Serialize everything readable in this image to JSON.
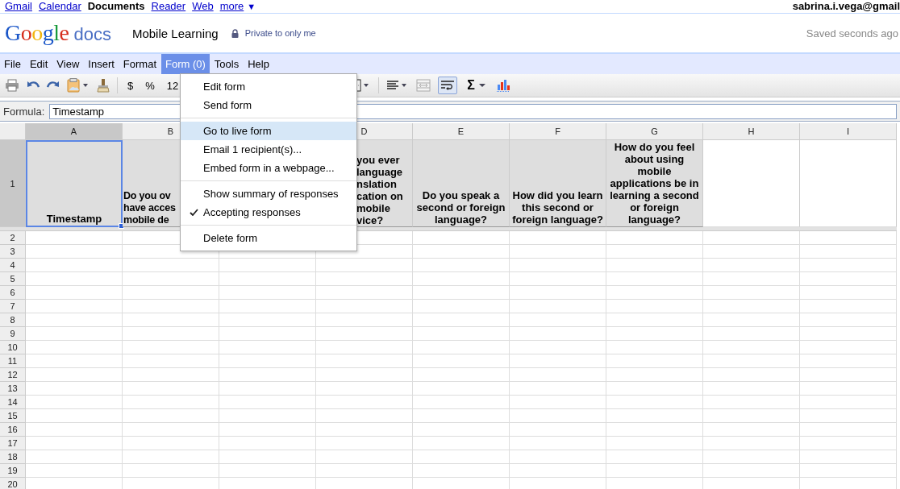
{
  "top_links": [
    {
      "label": "Gmail",
      "selected": false
    },
    {
      "label": "Calendar",
      "selected": false
    },
    {
      "label": "Documents",
      "selected": true
    },
    {
      "label": "Reader",
      "selected": false
    },
    {
      "label": "Web",
      "selected": false
    },
    {
      "label": "more",
      "selected": false
    }
  ],
  "more_arrow": "▼",
  "account": "sabrina.i.vega@gmail",
  "logo": {
    "brand": "Google",
    "product": "docs"
  },
  "doc_title": "Mobile Learning",
  "privacy": "Private to only me",
  "save_status": "Saved seconds ago",
  "menu": [
    {
      "label": "File",
      "selected": false
    },
    {
      "label": "Edit",
      "selected": false
    },
    {
      "label": "View",
      "selected": false
    },
    {
      "label": "Insert",
      "selected": false
    },
    {
      "label": "Format",
      "selected": false
    },
    {
      "label": "Form (0)",
      "selected": true
    },
    {
      "label": "Tools",
      "selected": false
    },
    {
      "label": "Help",
      "selected": false
    }
  ],
  "toolbar_left": [
    {
      "kind": "print"
    },
    {
      "kind": "undo"
    },
    {
      "kind": "redo"
    },
    {
      "kind": "paste"
    },
    {
      "kind": "brush"
    },
    {
      "kind": "sep"
    },
    {
      "kind": "text",
      "label": "$"
    },
    {
      "kind": "text",
      "label": "%"
    },
    {
      "kind": "text",
      "label": "12"
    }
  ],
  "toolbar_right": [
    {
      "kind": "borders"
    },
    {
      "kind": "sep"
    },
    {
      "kind": "align"
    },
    {
      "kind": "merge"
    },
    {
      "kind": "wrap",
      "on": true
    },
    {
      "kind": "sum",
      "label": "Σ"
    },
    {
      "kind": "chart"
    }
  ],
  "formula": {
    "label": "Formula:",
    "value": "Timestamp"
  },
  "columns": [
    {
      "label": "A",
      "selected": true
    },
    {
      "label": "B",
      "selected": false
    },
    {},
    {
      "label": "D",
      "selected": false
    },
    {
      "label": "E",
      "selected": false
    },
    {
      "label": "F",
      "selected": false
    },
    {
      "label": "G",
      "selected": false
    },
    {
      "label": "H",
      "selected": false
    },
    {
      "label": "I",
      "selected": false
    }
  ],
  "header_row": {
    "number": "1",
    "cells": [
      {
        "kind": "question",
        "text": "Timestamp",
        "selected": true
      },
      {
        "kind": "cut_right",
        "text": "Do you ov\nhave acces\nmobile de",
        "selected": false
      },
      {
        "kind": "question"
      },
      {
        "kind": "cut_left",
        "text": "you ever\nlanguage\nnslation\ncation on\nmobile\nvice?",
        "selected": false
      },
      {
        "kind": "question",
        "text": "Do you speak a second or foreign language?",
        "selected": false
      },
      {
        "kind": "question",
        "text": "How did you learn this second or foreign language?",
        "selected": false
      },
      {
        "kind": "question",
        "text": "How do you feel about using mobile applications be in learning a second or foreign language?",
        "selected": false
      },
      {
        "kind": "blank",
        "selected": false
      },
      {
        "kind": "blank",
        "selected": false
      }
    ]
  },
  "row_numbers": [
    "2",
    "3",
    "4",
    "5",
    "6",
    "7",
    "8",
    "9",
    "10",
    "11",
    "12",
    "13",
    "14",
    "15",
    "16",
    "17",
    "18",
    "19",
    "20"
  ],
  "form_menu": [
    [
      {
        "label": "Edit form",
        "selected": false,
        "checked": false
      },
      {
        "label": "Send form",
        "selected": false,
        "checked": false
      }
    ],
    [
      {
        "label": "Go to live form",
        "selected": true,
        "checked": false
      },
      {
        "label": "Email 1 recipient(s)...",
        "selected": false,
        "checked": false
      },
      {
        "label": "Embed form in a webpage...",
        "selected": false,
        "checked": false
      }
    ],
    [
      {
        "label": "Show summary of responses",
        "selected": false,
        "checked": false
      },
      {
        "label": "Accepting responses",
        "selected": false,
        "checked": true
      }
    ],
    [
      {
        "label": "Delete form",
        "selected": false,
        "checked": false
      }
    ]
  ]
}
